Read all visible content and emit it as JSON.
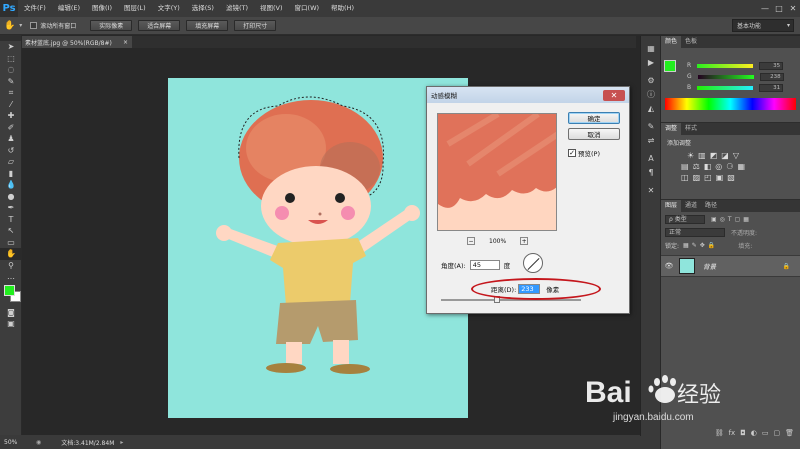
{
  "app": {
    "logo": "Ps"
  },
  "menu": [
    "文件(F)",
    "编辑(E)",
    "图像(I)",
    "图层(L)",
    "文字(Y)",
    "选择(S)",
    "滤镜(T)",
    "视图(V)",
    "窗口(W)",
    "帮助(H)"
  ],
  "window_controls": {
    "minimize": "—",
    "maximize": "□",
    "close": "✕"
  },
  "options_bar": {
    "scroll_all_label": "滚动所有窗口",
    "buttons": [
      "实际像素",
      "适合屏幕",
      "填充屏幕",
      "打印尺寸"
    ],
    "workspace": "基本功能"
  },
  "document": {
    "tab_title": "素材蓝底.jpg @ 50%(RGB/8#)",
    "close": "×"
  },
  "status": {
    "zoom": "50%",
    "doc_info": "文档:3.41M/2.84M"
  },
  "color_panel": {
    "tabs": [
      "颜色",
      "色板"
    ],
    "channels": [
      {
        "label": "R",
        "value": "35",
        "color": "#35d52a"
      },
      {
        "label": "G",
        "value": "238",
        "color": "#35d52a"
      },
      {
        "label": "B",
        "value": "31",
        "color": "#35d52a"
      }
    ],
    "foreground_color": "#22ee1f"
  },
  "adjust_panel": {
    "tabs": [
      "调整",
      "样式"
    ],
    "add_label": "添加调整"
  },
  "layers_panel": {
    "tabs": [
      "图层",
      "通道",
      "路径"
    ],
    "kind_label": "ρ 类型",
    "blend_mode": "正常",
    "opacity_label": "不透明度:",
    "lock_label": "锁定:",
    "fill_label": "填充:",
    "layer_name": "背景"
  },
  "dialog": {
    "title": "动感模糊",
    "ok": "确定",
    "cancel": "取消",
    "preview_label": "预览(P)",
    "zoom_out": "−",
    "zoom": "100%",
    "zoom_in": "+",
    "angle_label": "角度(A):",
    "angle_value": "45",
    "angle_unit": "度",
    "distance_label": "距离(D):",
    "distance_value": "233",
    "distance_unit": "像素"
  },
  "watermark": {
    "brand": "Baidu经验",
    "url": "jingyan.baidu.com"
  }
}
